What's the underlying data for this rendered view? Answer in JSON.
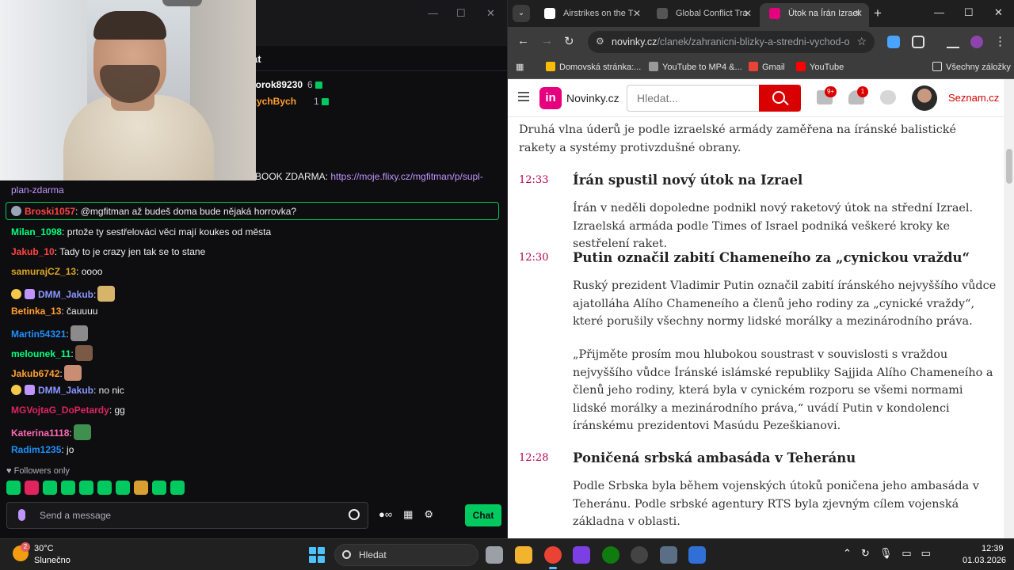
{
  "twitch": {
    "chat_header": "at",
    "leaderboard": [
      {
        "name": "rorok89230",
        "count": "6",
        "color": "#ffffff"
      },
      {
        "name": "zychBych",
        "count": "1",
        "color": "#ff9f2e"
      }
    ],
    "messages": [
      {
        "user": "",
        "text": "BOOK ZDARMA: ",
        "link": "https://moje.flixy.cz/mgfitman/p/supl-",
        "color": "#efeff1"
      },
      {
        "user": "",
        "text": "plan-zdarma",
        "link": "",
        "color": "#efeff1"
      },
      {
        "user": "Broski1057",
        "text": ": @mgfitman až budeš doma bude nějaká horrovka?",
        "color": "#ff4444",
        "highlighted": true
      },
      {
        "user": "Milan_1098",
        "text": ": prtože ty sestřelováci věci mají koukes od města",
        "color": "#00ff7f"
      },
      {
        "user": "Jakub_10",
        "text": ": Tady to je crazy jen tak se to stane",
        "color": "#ff4444"
      },
      {
        "user": "samurajCZ_13",
        "text": ": oooo",
        "color": "#daa520"
      },
      {
        "user": "DMM_Jakub",
        "text": ":",
        "color": "#8a96ff",
        "emote": "butterfly"
      },
      {
        "user": "Betinka_13",
        "text": ": čauuuu",
        "color": "#ff9f2e"
      },
      {
        "user": "Martin54321",
        "text": ":",
        "color": "#1e90ff",
        "emote": "cat"
      },
      {
        "user": "melounek_11",
        "text": ":",
        "color": "#00ff7f",
        "emote": "face"
      },
      {
        "user": "Jakub6742",
        "text": ":",
        "color": "#ff9f2e",
        "emote": "face"
      },
      {
        "user": "DMM_Jakub",
        "text": ": no nic",
        "color": "#8a96ff"
      },
      {
        "user": "MGVojtaG_DoPetardy",
        "text": ": gg",
        "color": "#e0245e"
      },
      {
        "user": "Katerina1118",
        "text": ":",
        "color": "#ff69b4",
        "emote": "frog"
      },
      {
        "user": "Radim1235",
        "text": ": jo",
        "color": "#1e90ff"
      }
    ],
    "followers_only": "Followers only",
    "input_placeholder": "Send a message",
    "chat_button": "Chat"
  },
  "chrome": {
    "tabs": [
      {
        "title": "Airstrikes on the T",
        "active": false
      },
      {
        "title": "Global Conflict Tra",
        "active": false
      },
      {
        "title": "Útok na Írán Izrael",
        "active": true
      }
    ],
    "url_domain": "novinky.cz",
    "url_path": "/clanek/zahranicni-blizky-a-stredni-vychod-o...",
    "bookmarks": [
      "Domovská stránka:...",
      "YouTube to MP4 &...",
      "Gmail",
      "YouTube"
    ],
    "all_bookmarks": "Všechny záložky"
  },
  "site": {
    "logo_mark": "in",
    "logo_text": "Novinky.cz",
    "search_placeholder": "Hledat...",
    "mail_badge": "9+",
    "bell_badge": "1",
    "seznam": "Seznam.cz"
  },
  "article": {
    "intro": "Druhá vlna úderů je podle izraelské armády zaměřena na íránské balistické rakety a systémy protivzdušné obrany.",
    "entries": [
      {
        "time": "12:33",
        "title": "Írán spustil nový útok na Izrael",
        "paragraphs": [
          "Írán v neděli dopoledne podnikl nový raketový útok na střední Izrael. Izraelská armáda podle Times of Israel podniká veškeré kroky ke sestřelení raket."
        ]
      },
      {
        "time": "12:30",
        "title": "Putin označil zabití Chameneího za „cynickou vraždu“",
        "paragraphs": [
          "Ruský prezident Vladimir Putin označil zabití íránského nejvyššího vůdce ajatolláha Alího Chameneího a členů jeho rodiny za „cynické vraždy“, které porušily všechny normy lidské morálky a mezinárodního práva.",
          "„Přijměte prosím mou hlubokou soustrast v souvislosti s vraždou nejvyššího vůdce Íránské islámské republiky Sajjida Alího Chameneího a členů jeho rodiny, která byla v cynickém rozporu se všemi normami lidské morálky a mezinárodního práva,“ uvádí Putin v kondolenci íránskému prezidentovi Masúdu Pezeškianovi."
        ]
      },
      {
        "time": "12:28",
        "title": "Poničená srbská ambasáda v Teheránu",
        "paragraphs": [
          "Podle Srbska byla během vojenských útoků poničena jeho ambasáda v Teheránu. Podle srbské agentury RTS byla zjevným cílem vojenská základna v oblasti."
        ]
      }
    ]
  },
  "taskbar": {
    "weather_temp": "30°C",
    "weather_desc": "Slunečno",
    "weather_badge": "2",
    "search": "Hledat",
    "time": "12:39",
    "date": "01.03.2026"
  }
}
